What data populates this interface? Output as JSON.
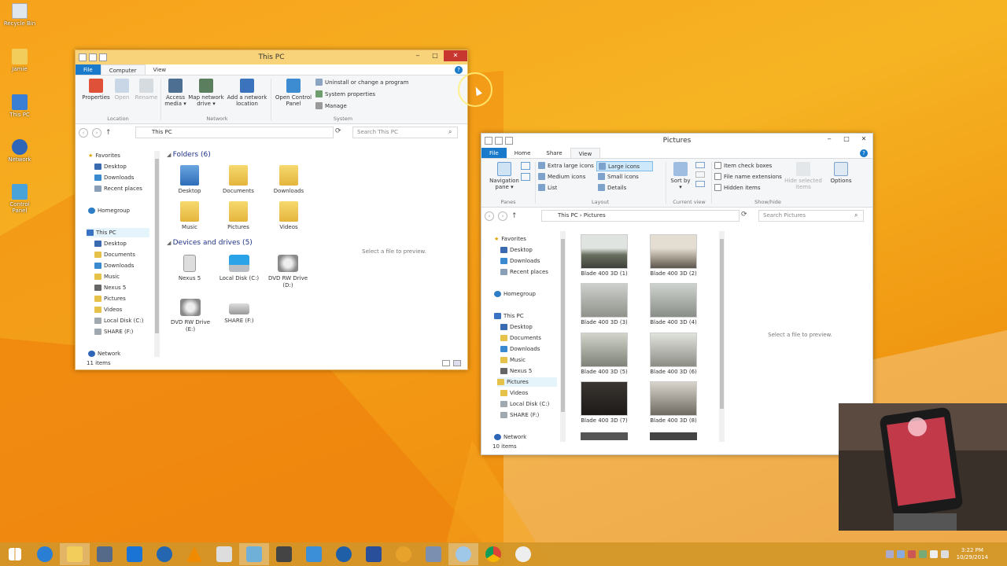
{
  "desktop": {
    "icons": [
      {
        "label": "Recycle Bin",
        "icon": "recycle-bin-icon"
      },
      {
        "label": "Jamie",
        "icon": "user-folder-icon"
      },
      {
        "label": "This PC",
        "icon": "computer-icon"
      },
      {
        "label": "Network",
        "icon": "network-icon"
      },
      {
        "label": "Control Panel",
        "icon": "control-panel-icon"
      }
    ]
  },
  "thispc": {
    "title": "This PC",
    "tabs": {
      "file": "File",
      "computer": "Computer",
      "view": "View"
    },
    "ribbon": {
      "properties": "Properties",
      "open": "Open",
      "rename": "Rename",
      "access_media": "Access media ▾",
      "map_drive": "Map network drive ▾",
      "add_location": "Add a network location",
      "open_cp": "Open Control Panel",
      "uninstall": "Uninstall or change a program",
      "system_props": "System properties",
      "manage": "Manage",
      "g_location": "Location",
      "g_network": "Network",
      "g_system": "System"
    },
    "address": "This PC",
    "search_placeholder": "Search This PC",
    "nav": {
      "favorites": "Favorites",
      "desktop": "Desktop",
      "downloads": "Downloads",
      "recent": "Recent places",
      "homegroup": "Homegroup",
      "thispc": "This PC",
      "desktop2": "Desktop",
      "documents": "Documents",
      "downloads2": "Downloads",
      "music": "Music",
      "nexus": "Nexus 5",
      "pictures": "Pictures",
      "videos": "Videos",
      "localdisk": "Local Disk (C:)",
      "share": "SHARE (F:)",
      "network": "Network"
    },
    "folders_header": "Folders (6)",
    "folders": [
      "Desktop",
      "Documents",
      "Downloads",
      "Music",
      "Pictures",
      "Videos"
    ],
    "devices_header": "Devices and drives (5)",
    "devices": [
      "Nexus 5",
      "Local Disk (C:)",
      "DVD RW Drive (D:)",
      "DVD RW Drive (E:)",
      "SHARE (F:)"
    ],
    "preview": "Select a file to preview.",
    "status": "11 items"
  },
  "pictures": {
    "title": "Pictures",
    "tabs": {
      "file": "File",
      "home": "Home",
      "share": "Share",
      "view": "View"
    },
    "ribbon": {
      "nav_pane": "Navigation pane ▾",
      "extra_large": "Extra large icons",
      "large": "Large icons",
      "medium": "Medium icons",
      "small": "Small icons",
      "list": "List",
      "details": "Details",
      "sort_by": "Sort by ▾",
      "item_check": "Item check boxes",
      "file_ext": "File name extensions",
      "hidden": "Hidden items",
      "hide_selected": "Hide selected items",
      "options": "Options",
      "g_panes": "Panes",
      "g_layout": "Layout",
      "g_current": "Current view",
      "g_showhide": "Show/hide"
    },
    "address": "This PC  ›  Pictures",
    "search_placeholder": "Search Pictures",
    "nav": {
      "favorites": "Favorites",
      "desktop": "Desktop",
      "downloads": "Downloads",
      "recent": "Recent places",
      "homegroup": "Homegroup",
      "thispc": "This PC",
      "desktop2": "Desktop",
      "documents": "Documents",
      "downloads2": "Downloads",
      "music": "Music",
      "nexus": "Nexus 5",
      "pictures": "Pictures",
      "videos": "Videos",
      "localdisk": "Local Disk (C:)",
      "share": "SHARE (F:)",
      "network": "Network"
    },
    "files": [
      "Blade 400 3D (1)",
      "Blade 400 3D (2)",
      "Blade 400 3D (3)",
      "Blade 400 3D (4)",
      "Blade 400 3D (5)",
      "Blade 400 3D (6)",
      "Blade 400 3D (7)",
      "Blade 400 3D (8)"
    ],
    "preview": "Select a file to preview.",
    "status": "10 items"
  },
  "taskbar": {
    "time": "3:22 PM",
    "date": "10/29/2014"
  },
  "colors": {
    "file_tab": "#1979ca",
    "title_active": "#f9d37a",
    "close": "#c7372f"
  }
}
